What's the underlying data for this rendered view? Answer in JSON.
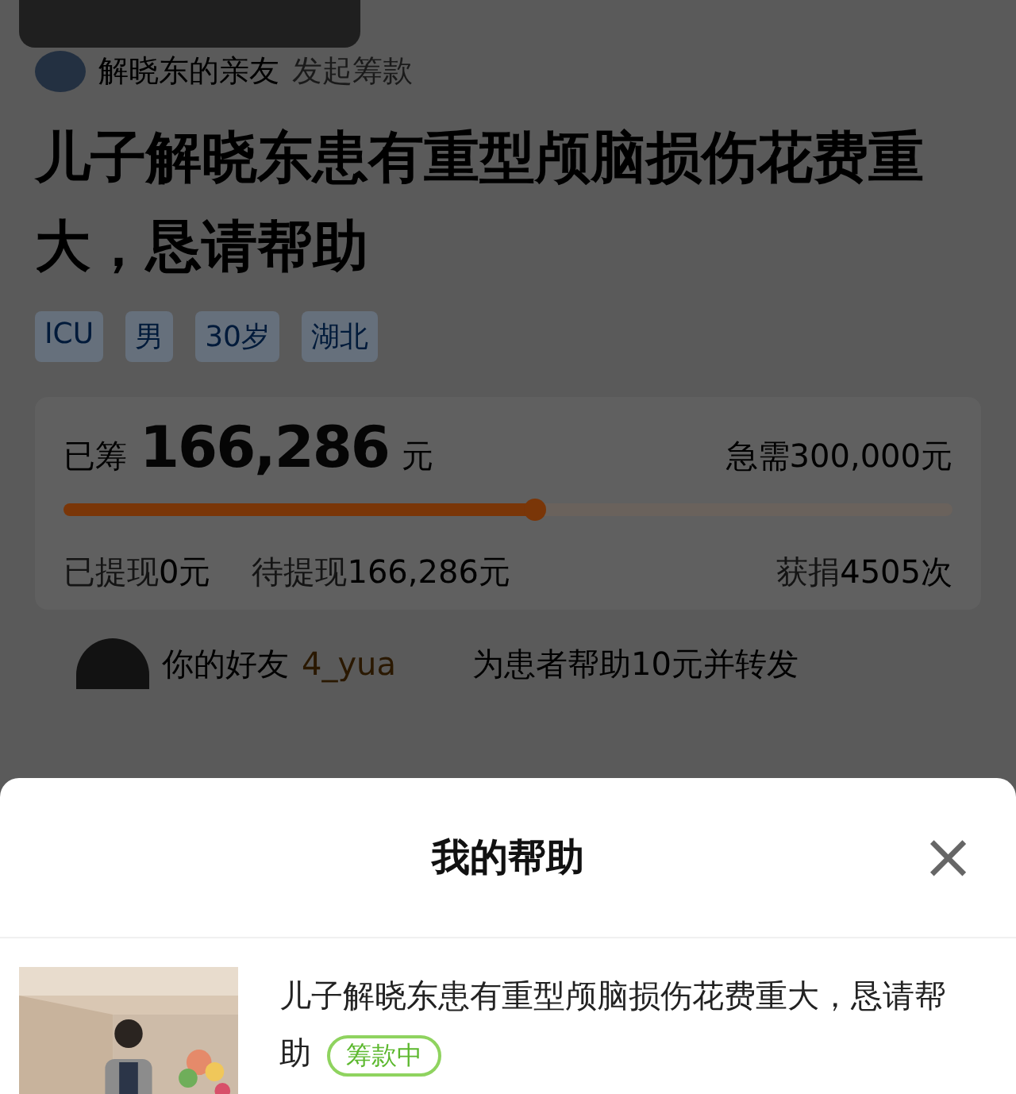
{
  "organizer": {
    "name": "解晓东的亲友",
    "action": "发起筹款"
  },
  "title": "儿子解晓东患有重型颅脑损伤花费重大，恳请帮助",
  "tags": [
    "ICU",
    "男",
    "30岁",
    "湖北"
  ],
  "stats": {
    "raised_label": "已筹",
    "raised": "166,286",
    "raised_unit": "元",
    "target": "急需300,000元",
    "level": 0.54,
    "withdrawn_label": "已提现",
    "withdrawn": "0元",
    "pending_label": "待提现",
    "pending": "166,286元",
    "donations_label": "获捐",
    "donations": "4505次"
  },
  "friend": {
    "label": "你的好友",
    "name": "4_yua",
    "action": "为患者帮助10元并转发"
  },
  "sheet": {
    "title": "我的帮助",
    "close": "×",
    "items": [
      {
        "kind": "picture",
        "title": "儿子解晓东患有重型颅脑损伤花费重大，恳请帮助",
        "badge": "筹款中"
      }
    ]
  }
}
